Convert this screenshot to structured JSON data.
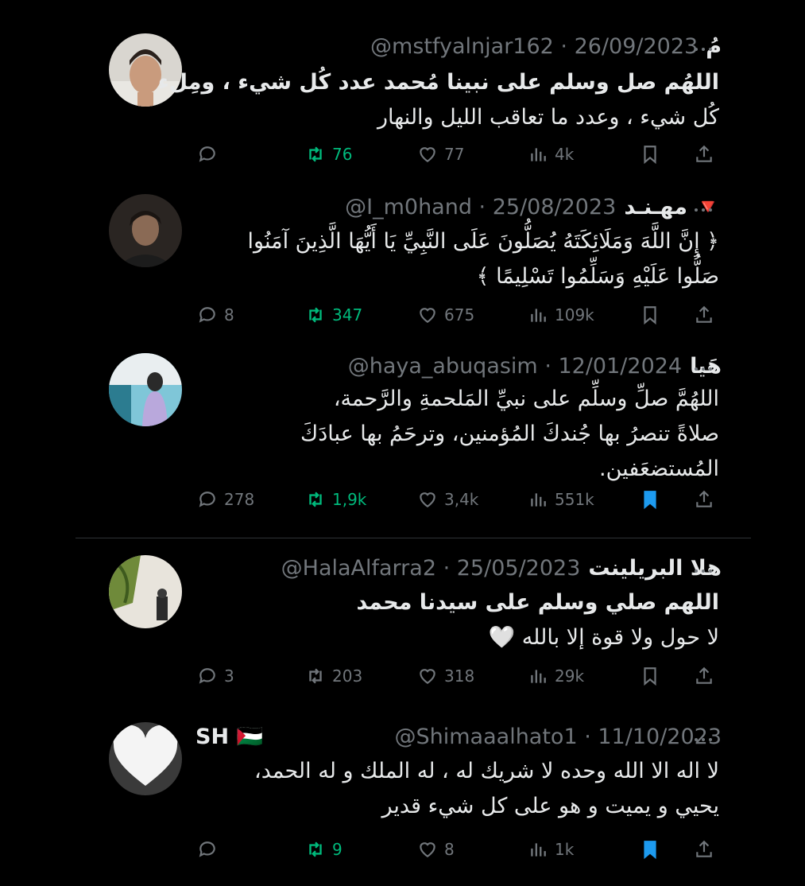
{
  "colors": {
    "background": "#000000",
    "text": "#e7e9ea",
    "muted": "#71767b",
    "repost_green": "#00ba7c",
    "bookmark_blue": "#1d9bf0"
  },
  "tweets": [
    {
      "name": "مُ",
      "handle": "@mstfyalnjar162 · 26/09/2023",
      "lines": [
        "اللهُم صل وسلم على نبينا مُحمد عدد كُل شيء ، ومِلء",
        "كُل شيء ، وعدد ما تعاقب الليل والنهار"
      ],
      "replies": "",
      "reposts": "76",
      "likes": "77",
      "views": "4k",
      "reposted": true,
      "bookmarked": false
    },
    {
      "name": "مهـنـد 🔻",
      "handle": "@I_m0hand · 25/08/2023",
      "lines": [
        "﴿ إِنَّ اللَّهَ وَمَلَائِكَتَهُ يُصَلُّونَ عَلَى النَّبِيِّ يَا أَيُّهَا الَّذِينَ آمَنُوا",
        "صَلُّوا عَلَيْهِ وَسَلِّمُوا تَسْلِيمًا ﴾"
      ],
      "replies": "8",
      "reposts": "347",
      "likes": "675",
      "views": "109k",
      "reposted": true,
      "bookmarked": false
    },
    {
      "name": "هَيا",
      "handle": "@haya_abuqasim · 12/01/2024",
      "lines": [
        "اللهُمَّ صلِّ وسلِّم على نبيِّ المَلحمةِ والرَّحمة،",
        "صلاةً تنصرُ بها جُندكَ المُؤمنين، وترحَمُ بها عبادَكَ",
        "المُستضعَفين."
      ],
      "replies": "278",
      "reposts": "1,9k",
      "likes": "3,4k",
      "views": "551k",
      "reposted": true,
      "bookmarked": true
    },
    {
      "name": "هلا البريلينت",
      "handle": "@HalaAlfarra2 · 25/05/2023",
      "lines": [
        "اللهم صلي وسلم على سيدنا محمد",
        "لا حول ولا قوة إلا بالله 🤍"
      ],
      "replies": "3",
      "reposts": "203",
      "likes": "318",
      "views": "29k",
      "reposted": false,
      "bookmarked": false
    },
    {
      "name": "SH 🇵🇸",
      "handle": "@Shimaaalhato1 · 11/10/2023",
      "lines": [
        "لا اله الا الله وحده لا شريك له ، له الملك و له الحمد،",
        "يحيي و يميت و هو على كل شيء قدير"
      ],
      "replies": "",
      "reposts": "9",
      "likes": "8",
      "views": "1k",
      "reposted": true,
      "bookmarked": true
    }
  ],
  "icons": [
    "reply-icon",
    "repost-icon",
    "like-icon",
    "views-icon",
    "bookmark-icon",
    "share-icon",
    "more-icon"
  ]
}
